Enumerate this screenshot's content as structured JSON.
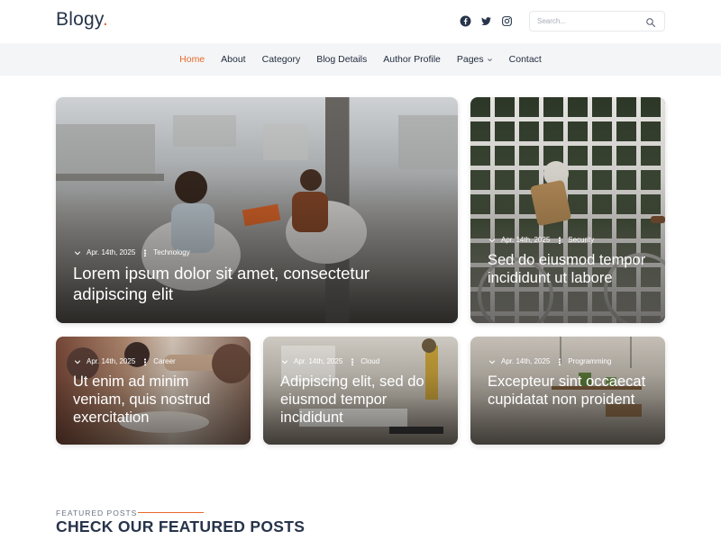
{
  "brand": {
    "name": "Blogy",
    "dot": ".",
    "accent": "#e8692b"
  },
  "social": [
    "facebook-icon",
    "twitter-icon",
    "instagram-icon"
  ],
  "search": {
    "placeholder": "Search..."
  },
  "nav": {
    "items": [
      {
        "label": "Home",
        "active": true
      },
      {
        "label": "About"
      },
      {
        "label": "Category"
      },
      {
        "label": "Blog Details"
      },
      {
        "label": "Author Profile"
      },
      {
        "label": "Pages",
        "dropdown": true
      },
      {
        "label": "Contact"
      }
    ]
  },
  "posts": [
    {
      "date": "Apr. 14th, 2025",
      "category": "Technology",
      "title": "Lorem ipsum dolor sit amet, consectetur adipiscing elit"
    },
    {
      "date": "Apr. 14th, 2025",
      "category": "Security",
      "title": "Sed do eiusmod tempor incididunt ut labore"
    },
    {
      "date": "Apr. 14th, 2025",
      "category": "Career",
      "title": "Ut enim ad minim veniam, quis nostrud exercitation"
    },
    {
      "date": "Apr. 14th, 2025",
      "category": "Cloud",
      "title": "Adipiscing elit, sed do eiusmod tempor incididunt"
    },
    {
      "date": "Apr. 14th, 2025",
      "category": "Programming",
      "title": "Excepteur sint occaecat cupidatat non proident"
    }
  ],
  "featured": {
    "label": "FEATURED POSTS",
    "title": "CHECK OUR FEATURED POSTS"
  }
}
